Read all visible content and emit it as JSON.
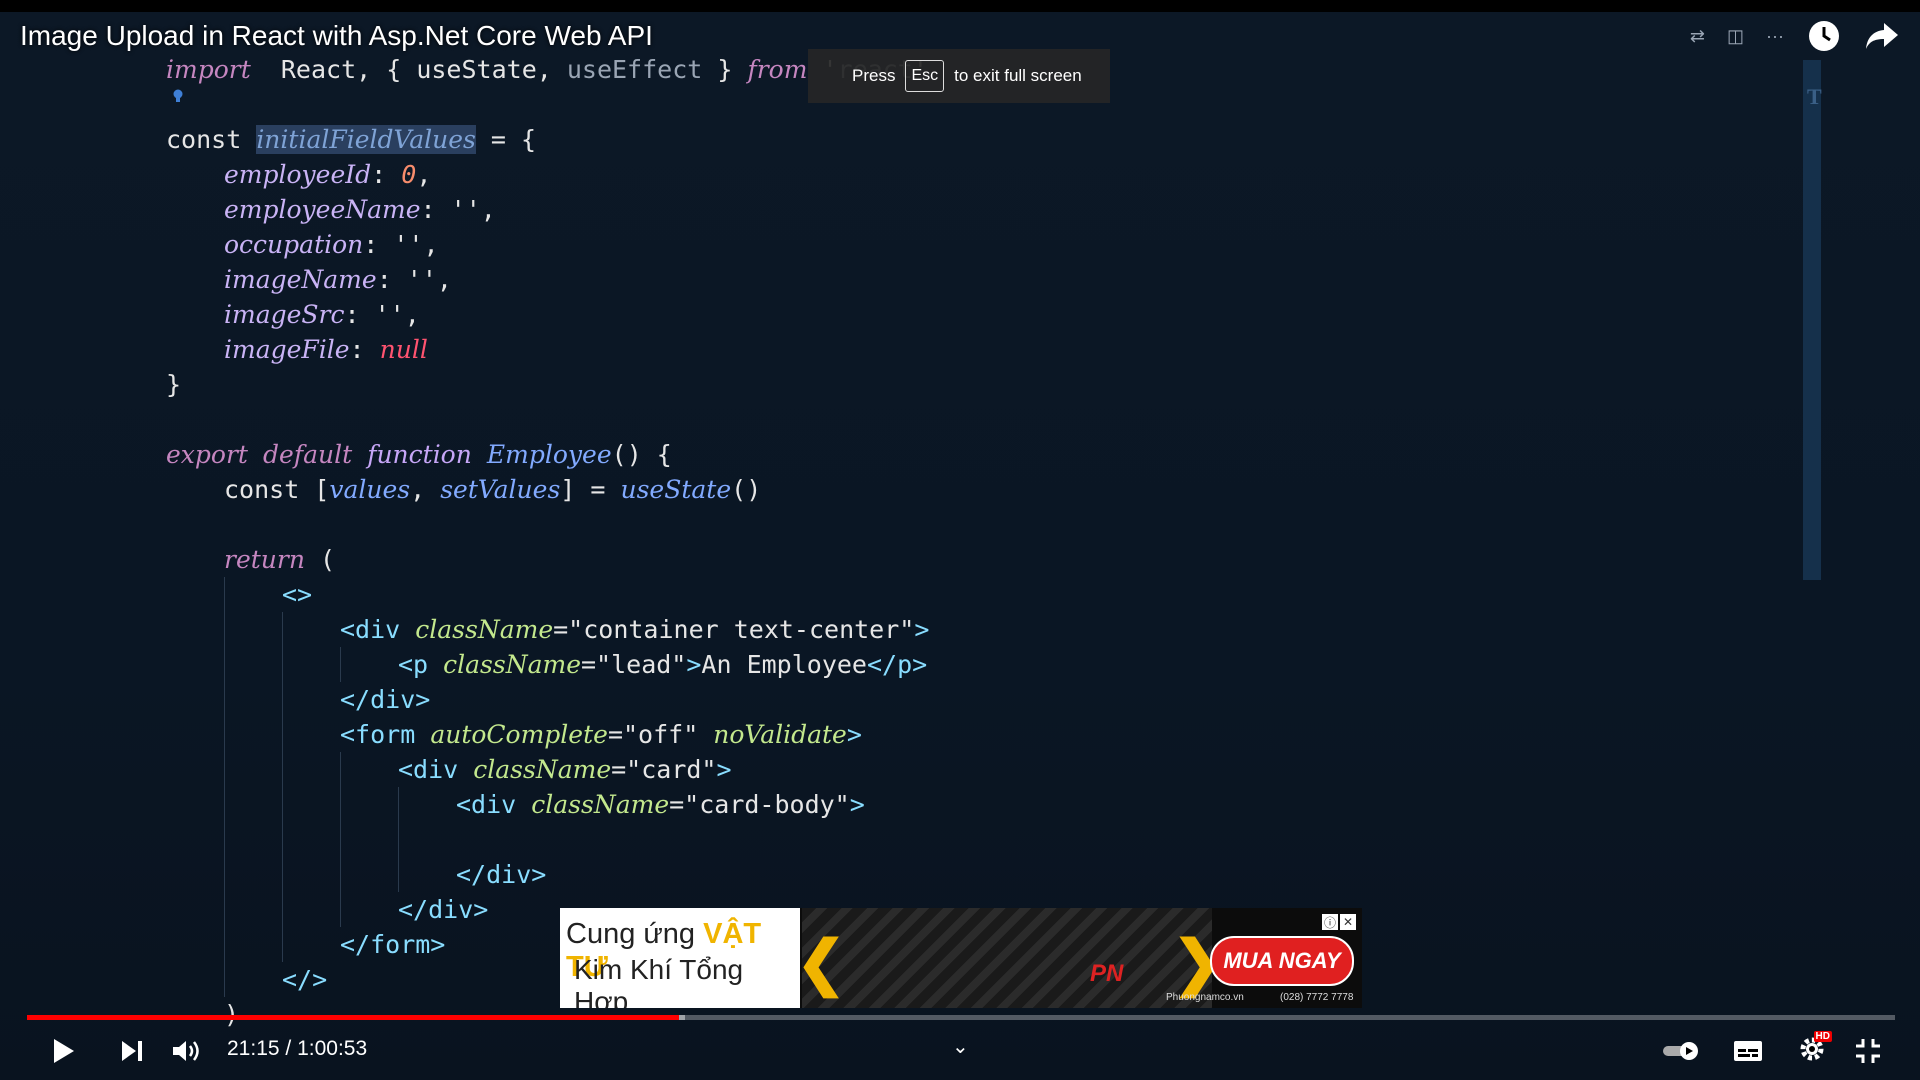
{
  "video": {
    "title": "Image Upload in React with Asp.Net Core Web API",
    "toast": {
      "press": "Press",
      "key": "Esc",
      "rest": "to exit full screen"
    }
  },
  "code": {
    "lines": [
      {
        "indent": 0,
        "tokens": [
          [
            "kw",
            "import"
          ],
          [
            "",
            "  React, { useState, "
          ],
          [
            "dim",
            "useEffect"
          ],
          [
            "",
            " } "
          ],
          [
            "kw",
            "from"
          ],
          [
            "",
            " '"
          ],
          [
            "dim",
            "react"
          ],
          [
            "",
            "'"
          ]
        ]
      },
      {
        "indent": 0,
        "tokens": []
      },
      {
        "indent": 0,
        "tokens": [
          [
            "",
            "const "
          ],
          [
            "sel",
            "initialFieldValues"
          ],
          [
            "",
            " = {"
          ]
        ]
      },
      {
        "indent": 1,
        "tokens": [
          [
            "prop",
            "employeeId"
          ],
          [
            "",
            ": "
          ],
          [
            "num",
            "0"
          ],
          [
            "",
            ","
          ]
        ]
      },
      {
        "indent": 1,
        "tokens": [
          [
            "prop",
            "employeeName"
          ],
          [
            "",
            ": '',"
          ]
        ]
      },
      {
        "indent": 1,
        "tokens": [
          [
            "prop",
            "occupation"
          ],
          [
            "",
            ": '',"
          ]
        ]
      },
      {
        "indent": 1,
        "tokens": [
          [
            "prop",
            "imageName"
          ],
          [
            "",
            ": '',"
          ]
        ]
      },
      {
        "indent": 1,
        "tokens": [
          [
            "prop",
            "imageSrc"
          ],
          [
            "",
            ": '',"
          ]
        ]
      },
      {
        "indent": 1,
        "tokens": [
          [
            "prop",
            "imageFile"
          ],
          [
            "",
            ": "
          ],
          [
            "null",
            "null"
          ]
        ]
      },
      {
        "indent": 0,
        "tokens": [
          [
            "",
            "}"
          ]
        ]
      },
      {
        "indent": 0,
        "tokens": []
      },
      {
        "indent": 0,
        "tokens": [
          [
            "kw",
            "export"
          ],
          [
            "",
            " "
          ],
          [
            "kw",
            "default"
          ],
          [
            "",
            " "
          ],
          [
            "it",
            "function"
          ],
          [
            "",
            " "
          ],
          [
            "fn",
            "Employee"
          ],
          [
            "",
            "() {"
          ]
        ]
      },
      {
        "indent": 1,
        "tokens": [
          [
            "",
            "const ["
          ],
          [
            "fn",
            "values"
          ],
          [
            "",
            ", "
          ],
          [
            "fn",
            "setValues"
          ],
          [
            "",
            "] = "
          ],
          [
            "fn",
            "useState"
          ],
          [
            "",
            "()"
          ]
        ]
      },
      {
        "indent": 1,
        "tokens": []
      },
      {
        "indent": 1,
        "tokens": [
          [
            "kw",
            "return"
          ],
          [
            "",
            " ("
          ]
        ]
      },
      {
        "indent": 2,
        "tokens": [
          [
            "tag",
            "<>"
          ]
        ]
      },
      {
        "indent": 3,
        "tokens": [
          [
            "tag",
            "<div "
          ],
          [
            "attr",
            "className"
          ],
          [
            "",
            "=\"container text-center\""
          ],
          [
            "tag",
            ">"
          ]
        ]
      },
      {
        "indent": 4,
        "tokens": [
          [
            "tag",
            "<p "
          ],
          [
            "attr",
            "className"
          ],
          [
            "",
            "=\"lead\""
          ],
          [
            "tag",
            ">"
          ],
          [
            "",
            "An Employee"
          ],
          [
            "tag",
            "</p>"
          ]
        ]
      },
      {
        "indent": 3,
        "tokens": [
          [
            "tag",
            "</div>"
          ]
        ]
      },
      {
        "indent": 3,
        "tokens": [
          [
            "tag",
            "<form "
          ],
          [
            "attr",
            "autoComplete"
          ],
          [
            "",
            "=\"off\" "
          ],
          [
            "attr",
            "noValidate"
          ],
          [
            "tag",
            ">"
          ]
        ]
      },
      {
        "indent": 4,
        "tokens": [
          [
            "tag",
            "<div "
          ],
          [
            "attr",
            "className"
          ],
          [
            "",
            "=\"card\""
          ],
          [
            "tag",
            ">"
          ]
        ]
      },
      {
        "indent": 5,
        "tokens": [
          [
            "tag",
            "<div "
          ],
          [
            "attr",
            "className"
          ],
          [
            "",
            "=\"card-body\""
          ],
          [
            "tag",
            ">"
          ]
        ]
      },
      {
        "indent": 5,
        "tokens": []
      },
      {
        "indent": 5,
        "tokens": [
          [
            "tag",
            "</div>"
          ]
        ]
      },
      {
        "indent": 4,
        "tokens": [
          [
            "tag",
            "</div>"
          ]
        ]
      },
      {
        "indent": 3,
        "tokens": [
          [
            "tag",
            "</form>"
          ]
        ]
      },
      {
        "indent": 2,
        "tokens": [
          [
            "tag",
            "</>"
          ]
        ]
      },
      {
        "indent": 1,
        "tokens": [
          [
            "",
            ")"
          ]
        ]
      }
    ]
  },
  "ad": {
    "line1_prefix": "Cung ứng ",
    "line1_bold": "VẬT TƯ",
    "line2": "Kim Khí Tổng Hợp",
    "logo": "PN",
    "cta": "MUA NGAY",
    "site": "Phuongnamco.vn",
    "phone": "(028) 7772 7778"
  },
  "player": {
    "current_time": "21:15",
    "separator": " / ",
    "duration": "1:00:53",
    "played_fraction": 0.349,
    "loaded_fraction": 0.352,
    "autoplay": "on",
    "quality_badge": "HD"
  },
  "colors": {
    "progress_played": "#ff0000",
    "ad_cta": "#e02020",
    "ad_accent": "#f0b400"
  }
}
